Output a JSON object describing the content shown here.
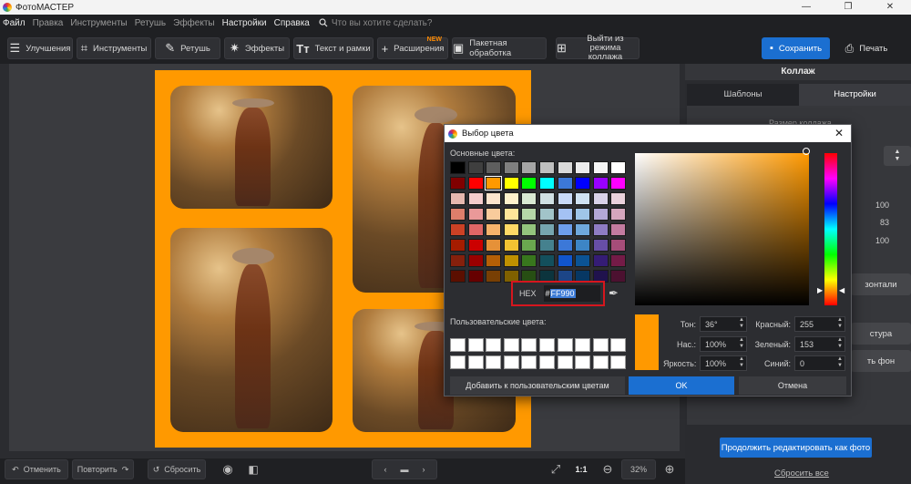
{
  "app": {
    "title": "ФотоМАСТЕР"
  },
  "window_controls": {
    "minimize": "—",
    "maximize": "❐",
    "close": "✕"
  },
  "menu": {
    "items": [
      "Файл",
      "Правка",
      "Инструменты",
      "Ретушь",
      "Эффекты",
      "Настройки",
      "Справка"
    ],
    "search_placeholder": "Что вы хотите сделать?"
  },
  "toolbar": {
    "improve": "Улучшения",
    "tools": "Инструменты",
    "retouch": "Ретушь",
    "effects": "Эффекты",
    "text": "Текст и рамки",
    "extensions": "Расширения",
    "extensions_badge": "NEW",
    "batch": "Пакетная обработка",
    "exit_collage_1": "Выйти из режима",
    "exit_collage_2": "коллажа",
    "save": "Сохранить",
    "print": "Печать"
  },
  "right_panel": {
    "header": "Коллаж",
    "tabs": [
      "Шаблоны",
      "Настройки"
    ],
    "partial_heading": "Размер коллажа",
    "values": [
      "100",
      "83",
      "100"
    ],
    "btn_horizontal_partial": "зонтали",
    "btn_texture_partial": "стура",
    "btn_bg_partial": "ть фон",
    "continue_btn": "Продолжить редактировать как фото",
    "reset_all": "Сбросить все"
  },
  "bottom": {
    "undo": "Отменить",
    "redo": "Повторить",
    "reset": "Сбросить",
    "ratio": "1:1",
    "zoom": "32%"
  },
  "dialog": {
    "title": "Выбор цвета",
    "basic_label": "Основные цвета:",
    "custom_label": "Пользовательские цвета:",
    "hex_label": "HEX",
    "hex_prefix": "#",
    "hex_value": "FF990",
    "hue_label": "Тон:",
    "hue_value": "36°",
    "sat_label": "Нас.:",
    "sat_value": "100%",
    "bright_label": "Яркость:",
    "bright_value": "100%",
    "red_label": "Красный:",
    "red_value": "255",
    "green_label": "Зеленый:",
    "green_value": "153",
    "blue_label": "Синий:",
    "blue_value": "0",
    "add_custom": "Добавить к пользовательским цветам",
    "ok": "OK",
    "cancel": "Отмена",
    "selected_color": "#FF9900",
    "basic_colors": [
      "#000000",
      "#3f3f3f",
      "#5e5e5e",
      "#7f7f7f",
      "#a5a5a5",
      "#bfbfbf",
      "#d9d9d9",
      "#ececec",
      "#f5f5f5",
      "#ffffff",
      "#800000",
      "#ff0000",
      "#ff9900",
      "#ffff00",
      "#00ff00",
      "#00ffff",
      "#3c78d8",
      "#0000ff",
      "#9900ff",
      "#ff00ff",
      "#e6b8af",
      "#f4cccc",
      "#fce5cd",
      "#fff2cc",
      "#d9ead3",
      "#d0e0e3",
      "#c9daf8",
      "#cfe2f3",
      "#d9d2e9",
      "#ead1dc",
      "#dd7e6b",
      "#ea9999",
      "#f9cb9c",
      "#ffe599",
      "#b6d7a8",
      "#a2c4c9",
      "#a4c2f4",
      "#9fc5e8",
      "#b4a7d6",
      "#d5a6bd",
      "#cc4125",
      "#e06666",
      "#f6b26b",
      "#ffd966",
      "#93c47d",
      "#76a5af",
      "#6d9eeb",
      "#6fa8dc",
      "#8e7cc3",
      "#c27ba0",
      "#a61c00",
      "#cc0000",
      "#e69138",
      "#f1c232",
      "#6aa84f",
      "#45818e",
      "#3c78d8",
      "#3d85c6",
      "#674ea7",
      "#a64d79",
      "#85200c",
      "#990000",
      "#b45f06",
      "#bf9000",
      "#38761d",
      "#134f5c",
      "#1155cc",
      "#0b5394",
      "#351c75",
      "#741b47",
      "#5b0f00",
      "#660000",
      "#783f04",
      "#7f6000",
      "#274e13",
      "#0c343d",
      "#1c4587",
      "#073763",
      "#20124d",
      "#4c1130"
    ]
  }
}
